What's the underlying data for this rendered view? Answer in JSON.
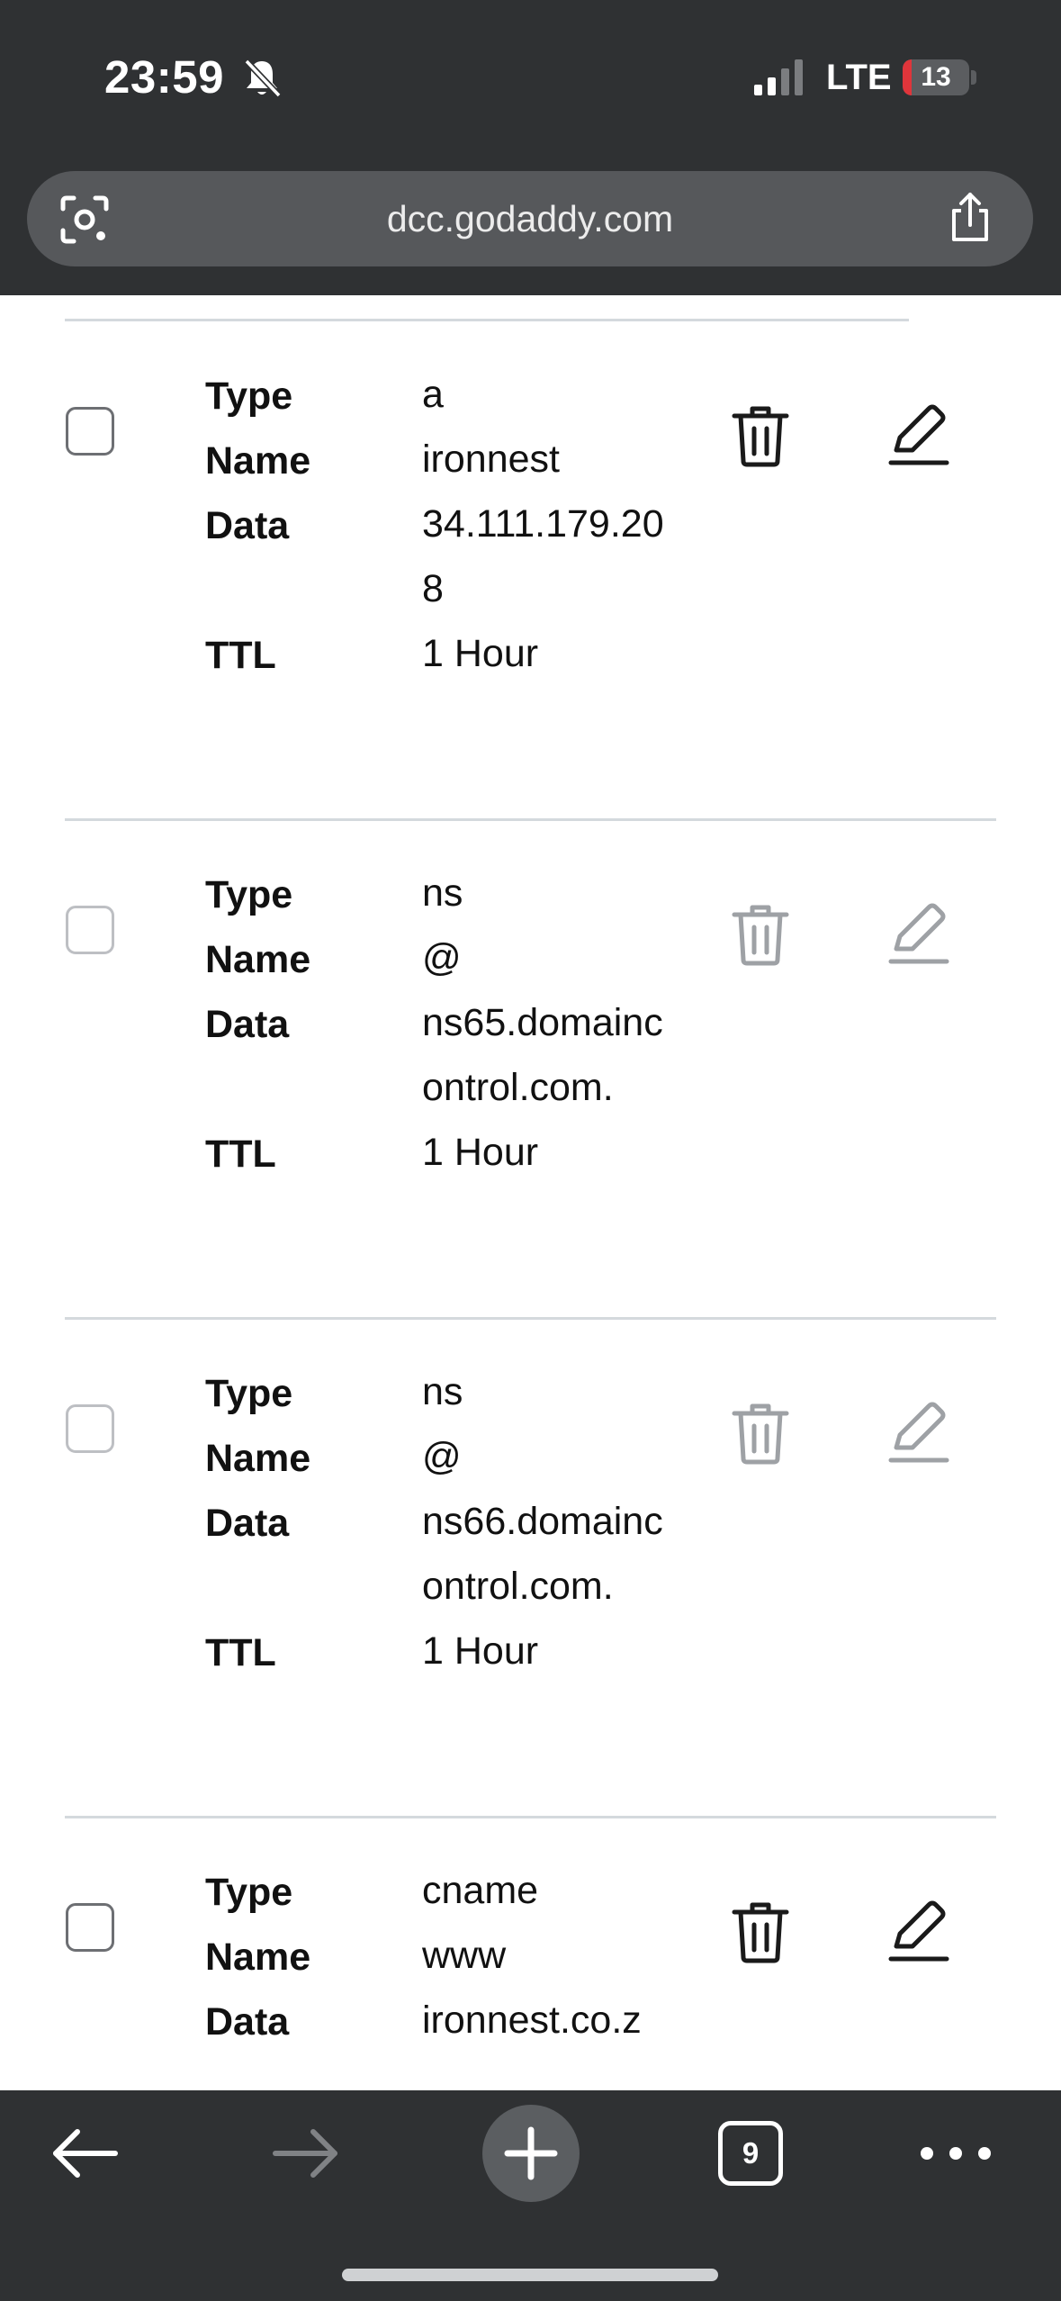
{
  "status_bar": {
    "time": "23:59",
    "silent_icon": "bell-slash-icon",
    "network": "LTE",
    "battery_level": "13",
    "battery_percent": 13,
    "battery_color": "#e0353b"
  },
  "browser": {
    "url": "dcc.godaddy.com",
    "lens_icon": "lens-icon",
    "share_icon": "share-icon"
  },
  "labels": {
    "type": "Type",
    "name": "Name",
    "data": "Data",
    "ttl": "TTL"
  },
  "records": [
    {
      "type": "a",
      "name": "ironnest",
      "data_line1": "34.111.179.20",
      "data_line2": "8",
      "ttl": "1 Hour",
      "actions_enabled": true
    },
    {
      "type": "ns",
      "name": "@",
      "data_line1": "ns65.domainc",
      "data_line2": "ontrol.com.",
      "ttl": "1 Hour",
      "actions_enabled": false
    },
    {
      "type": "ns",
      "name": "@",
      "data_line1": "ns66.domainc",
      "data_line2": "ontrol.com.",
      "ttl": "1 Hour",
      "actions_enabled": false
    },
    {
      "type": "cname",
      "name": "www",
      "data_line1": "ironnest.co.z",
      "data_line2": "",
      "ttl": "",
      "actions_enabled": true
    }
  ],
  "colors": {
    "active_icon": "#1a1a1a",
    "disabled_icon": "#9ea1a5",
    "divider": "#d4d9dd",
    "chrome_bg": "#2f3133"
  },
  "toolbar": {
    "tab_count": "9",
    "back_icon": "arrow-left-icon",
    "forward_icon": "arrow-right-icon",
    "new_tab_icon": "plus-icon",
    "more_icon": "more-horizontal-icon"
  }
}
